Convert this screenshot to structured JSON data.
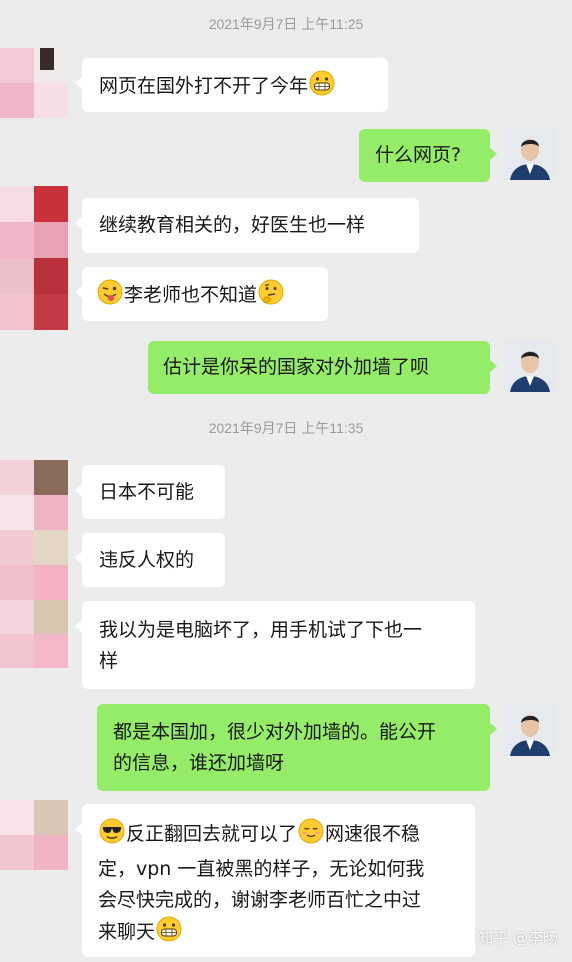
{
  "timestamps": [
    "2021年9月7日 上午11:25",
    "2021年9月7日 上午11:35"
  ],
  "messages": [
    {
      "text": "网页在国外打不开了今年",
      "emoji_after": "grinning-face-emoji"
    },
    {
      "text": "什么网页?"
    },
    {
      "text": "继续教育相关的，好医生也一样"
    },
    {
      "emoji_before": "winking-tongue-face-emoji",
      "text": "李老师也不知道",
      "emoji_after": "thinking-face-emoji"
    },
    {
      "text": "估计是你呆的国家对外加墙了呗"
    },
    {
      "text": "日本不可能"
    },
    {
      "text": "违反人权的"
    },
    {
      "line1": "我以为是电脑坏了，用手机试了下也一",
      "line2": "样"
    },
    {
      "line1": "都是本国加，很少对外加墙的。能公开",
      "line2": "的信息，谁还加墙呀"
    },
    {
      "seg1": "反正翻回去就可以了",
      "seg2": "网速很不稳",
      "line2": "定，vpn 一直被黑的样子，无论如何我",
      "line3": "会尽快完成的，谢谢李老师百忙之中过",
      "line4": "来聊天"
    }
  ],
  "watermark": "知乎 @李旸"
}
